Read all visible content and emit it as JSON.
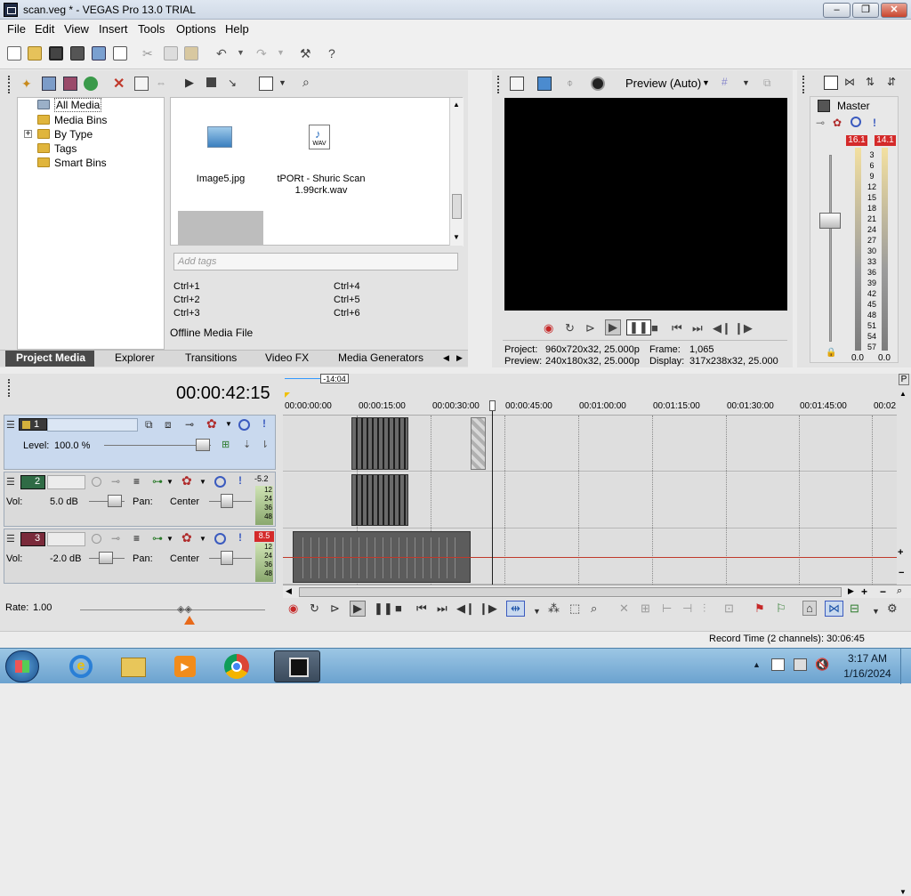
{
  "window": {
    "title": "scan.veg * - VEGAS Pro 13.0 TRIAL",
    "min": "‒",
    "max": "❐",
    "close": "✕"
  },
  "menu": [
    "File",
    "Edit",
    "View",
    "Insert",
    "Tools",
    "Options",
    "Help"
  ],
  "media_panel": {
    "tree": [
      {
        "label": "All Media",
        "selected": true
      },
      {
        "label": "Media Bins"
      },
      {
        "label": "By Type",
        "expander": "+"
      },
      {
        "label": "Tags"
      },
      {
        "label": "Smart Bins"
      }
    ],
    "files": [
      {
        "name": "Image5.jpg",
        "icon": "image-icon"
      },
      {
        "name": "tPORt - Shuric Scan 1.99crk.wav",
        "icon": "wav-icon",
        "badge": "WAV"
      }
    ],
    "tags_placeholder": "Add tags",
    "shortcuts": [
      "Ctrl+1",
      "Ctrl+4",
      "Ctrl+2",
      "Ctrl+5",
      "Ctrl+3",
      "Ctrl+6"
    ],
    "status": "Offline Media File"
  },
  "tabs": [
    "Project Media",
    "Explorer",
    "Transitions",
    "Video FX",
    "Media Generators"
  ],
  "preview": {
    "mode": "Preview (Auto)",
    "project_label": "Project:",
    "project": "960x720x32, 25.000p",
    "preview_label": "Preview:",
    "preview": "240x180x32, 25.000p",
    "frame_label": "Frame:",
    "frame": "1,065",
    "display_label": "Display:",
    "display": "317x238x32, 25.000"
  },
  "master": {
    "label": "Master",
    "peak_left": "16.1",
    "peak_right": "14.1",
    "scale": [
      "3",
      "6",
      "9",
      "12",
      "15",
      "18",
      "21",
      "24",
      "27",
      "30",
      "33",
      "36",
      "39",
      "42",
      "45",
      "48",
      "51",
      "54",
      "57"
    ],
    "out_left": "0.0",
    "out_right": "0.0"
  },
  "timeline": {
    "time": "00:00:42:15",
    "marker": "-14:04",
    "ruler": [
      "00:00:00:00",
      "00:00:15:00",
      "00:00:30:00",
      "00:00:45:00",
      "00:01:00:00",
      "00:01:15:00",
      "00:01:30:00",
      "00:01:45:00",
      "00:02"
    ],
    "tracks": [
      {
        "num": "1",
        "type": "video",
        "level_label": "Level:",
        "level": "100.0 %"
      },
      {
        "num": "2",
        "type": "audio",
        "vol_label": "Vol:",
        "vol": "5.0 dB",
        "pan_label": "Pan:",
        "pan": "Center",
        "peak": "-5.2",
        "meter": [
          "12",
          "24",
          "36",
          "48"
        ]
      },
      {
        "num": "3",
        "type": "audio",
        "vol_label": "Vol:",
        "vol": "-2.0 dB",
        "pan_label": "Pan:",
        "pan": "Center",
        "peak": "8.5",
        "meter": [
          "12",
          "24",
          "36",
          "48"
        ]
      }
    ],
    "rate_label": "Rate:",
    "rate": "1.00",
    "record_time": "Record Time (2 channels): 30:06:45"
  },
  "taskbar": {
    "clock_time": "3:17 AM",
    "clock_date": "1/16/2024",
    "up_arrow": "▲"
  },
  "colors": {
    "accent": "#3399ff",
    "peak_red": "#d42a2a",
    "track_blue": "#c9d9ee"
  }
}
